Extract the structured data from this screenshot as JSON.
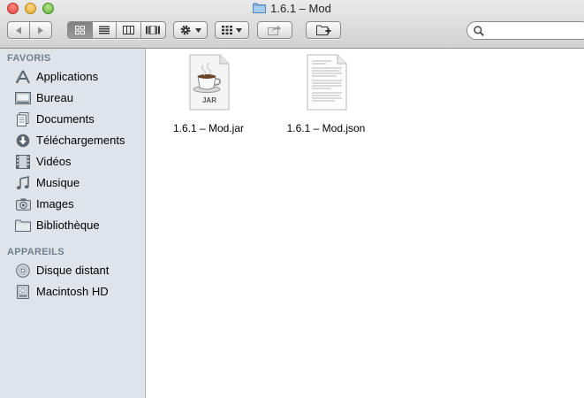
{
  "window": {
    "title": "1.6.1 – Mod"
  },
  "toolbar": {
    "back_icon": "chevron-left-icon",
    "forward_icon": "chevron-right-icon",
    "views": [
      "icon-view",
      "list-view",
      "column-view",
      "coverflow-view"
    ],
    "action_icon": "gear-icon",
    "arrange_icon": "grid-icon",
    "share_icon": "share-icon",
    "newfolder_icon": "new-folder-icon",
    "search_placeholder": ""
  },
  "sidebar": {
    "favorites_header": "FAVORIS",
    "favorites": [
      {
        "label": "Applications",
        "icon": "applications-icon"
      },
      {
        "label": "Bureau",
        "icon": "desktop-icon"
      },
      {
        "label": "Documents",
        "icon": "documents-icon"
      },
      {
        "label": "Téléchargements",
        "icon": "downloads-icon"
      },
      {
        "label": "Vidéos",
        "icon": "movies-icon"
      },
      {
        "label": "Musique",
        "icon": "music-icon"
      },
      {
        "label": "Images",
        "icon": "camera-icon"
      },
      {
        "label": "Bibliothèque",
        "icon": "folder-icon"
      }
    ],
    "devices_header": "APPAREILS",
    "devices": [
      {
        "label": "Disque distant",
        "icon": "optical-disc-icon"
      },
      {
        "label": "Macintosh HD",
        "icon": "hard-drive-icon"
      }
    ]
  },
  "files": [
    {
      "name": "1.6.1 – Mod.jar",
      "badge": "JAR",
      "icon": "jar-file-icon"
    },
    {
      "name": "1.6.1 – Mod.json",
      "icon": "text-document-icon"
    }
  ],
  "colors": {
    "sidebar_bg": "#dee4ea",
    "section_header": "#707e8b"
  }
}
